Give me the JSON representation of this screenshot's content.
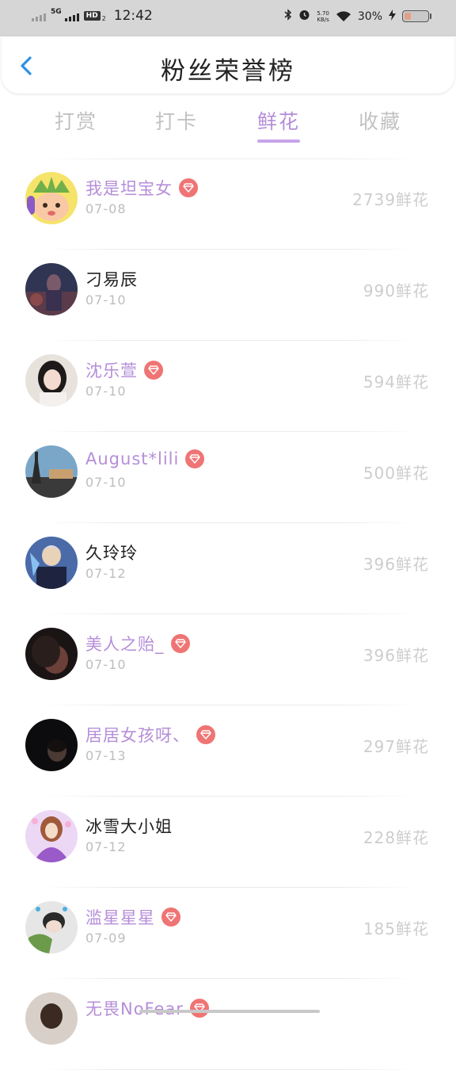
{
  "status_bar": {
    "network": "5G",
    "hd": "HD",
    "hd_sub": "2",
    "time": "12:42",
    "speed_value": "5.70",
    "speed_unit": "KB/s",
    "battery_pct": "30%",
    "battery_level": 0.3
  },
  "header": {
    "title": "粉丝荣誉榜"
  },
  "tabs": [
    {
      "label": "打赏",
      "active": false
    },
    {
      "label": "打卡",
      "active": false
    },
    {
      "label": "鲜花",
      "active": true
    },
    {
      "label": "收藏",
      "active": false
    }
  ],
  "rows": [
    {
      "name": "我是坦宝女",
      "date": "07-08",
      "flowers": "2739鲜花",
      "vip": true
    },
    {
      "name": "刁易辰",
      "date": "07-10",
      "flowers": "990鲜花",
      "vip": false
    },
    {
      "name": "沈乐萱",
      "date": "07-10",
      "flowers": "594鲜花",
      "vip": true
    },
    {
      "name": "August*lili",
      "date": "07-10",
      "flowers": "500鲜花",
      "vip": true
    },
    {
      "name": "久玲玲",
      "date": "07-12",
      "flowers": "396鲜花",
      "vip": false
    },
    {
      "name": "美人之贻_",
      "date": "07-10",
      "flowers": "396鲜花",
      "vip": true
    },
    {
      "name": "居居女孩呀、",
      "date": "07-13",
      "flowers": "297鲜花",
      "vip": true
    },
    {
      "name": "冰雪大小姐",
      "date": "07-12",
      "flowers": "228鲜花",
      "vip": false
    },
    {
      "name": "滥星星星",
      "date": "07-09",
      "flowers": "185鲜花",
      "vip": true
    },
    {
      "name": "无畏NoFear",
      "date": "",
      "flowers": "",
      "vip": true
    }
  ],
  "colors": {
    "accent": "#b58ed8",
    "vip_badge": "#ef7474",
    "back_icon": "#2f8fe6"
  }
}
